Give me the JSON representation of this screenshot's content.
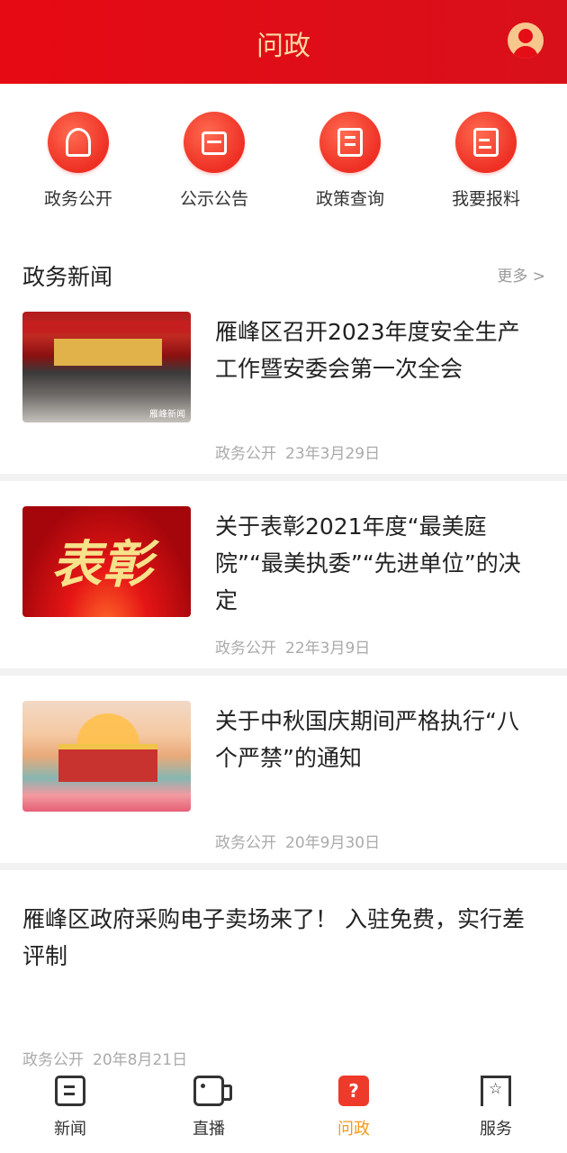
{
  "header": {
    "title": "问政"
  },
  "quick_links": [
    {
      "label": "政务公开",
      "icon": "person-document-icon"
    },
    {
      "label": "公示公告",
      "icon": "briefcase-icon"
    },
    {
      "label": "政策查询",
      "icon": "document-icon"
    },
    {
      "label": "我要报料",
      "icon": "edit-icon"
    }
  ],
  "section": {
    "title": "政务新闻",
    "more": "更多 >"
  },
  "news": [
    {
      "title": "雁峰区召开2023年度安全生产工作暨安委会第一次全会",
      "source": "政务公开",
      "date": "23年3月29日"
    },
    {
      "title": "关于表彰2021年度“最美庭院”“最美执委”“先进单位”的决定",
      "source": "政务公开",
      "date": "22年3月9日",
      "thumb_text": "表彰"
    },
    {
      "title": "关于中秋国庆期间严格执行“八个严禁”的通知",
      "source": "政务公开",
      "date": "20年9月30日"
    },
    {
      "title": "雁峰区政府采购电子卖场来了！ 入驻免费，实行差评制",
      "source": "政务公开",
      "date": "20年8月21日"
    }
  ],
  "tabbar": [
    {
      "label": "新闻",
      "icon": "news-icon",
      "active": false
    },
    {
      "label": "直播",
      "icon": "live-video-icon",
      "active": false
    },
    {
      "label": "问政",
      "icon": "ask-icon",
      "active": true
    },
    {
      "label": "服务",
      "icon": "service-bookmark-icon",
      "active": false
    }
  ],
  "colors": {
    "header_red": "#e60a14",
    "accent_gold": "#fbd8a0",
    "active_tab": "#f39a1a"
  }
}
